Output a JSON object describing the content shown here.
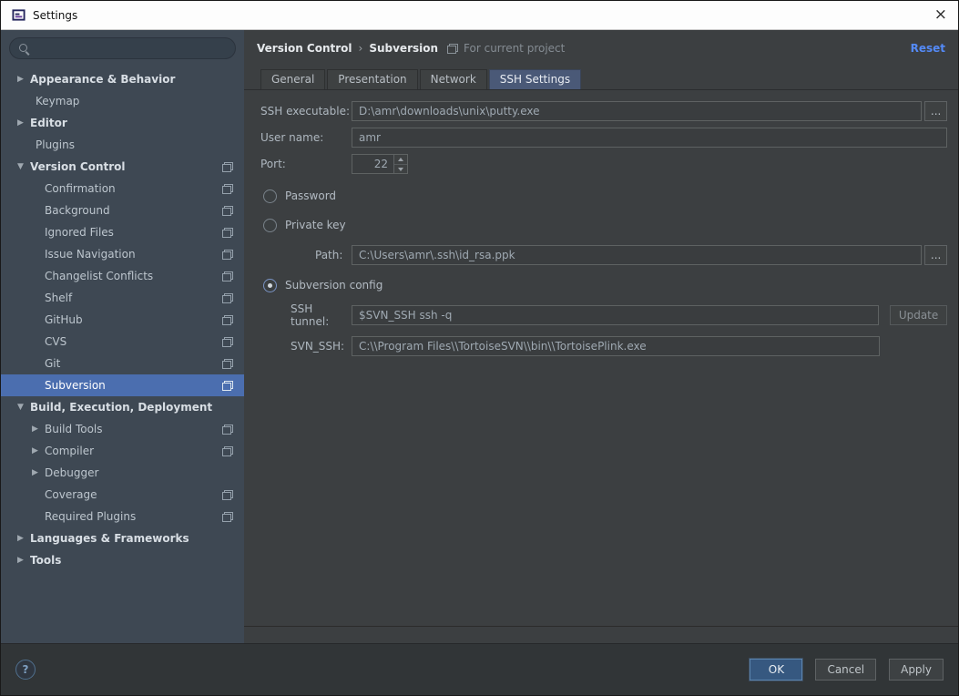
{
  "window": {
    "title": "Settings",
    "close_glyph": "×"
  },
  "colors": {
    "selection": "#4B6EAF",
    "link": "#548AF7",
    "ok_button": "#365880"
  },
  "sidebar": {
    "items": [
      {
        "label": "Appearance & Behavior"
      },
      {
        "label": "Keymap"
      },
      {
        "label": "Editor"
      },
      {
        "label": "Plugins"
      },
      {
        "label": "Version Control"
      },
      {
        "label": "Confirmation"
      },
      {
        "label": "Background"
      },
      {
        "label": "Ignored Files"
      },
      {
        "label": "Issue Navigation"
      },
      {
        "label": "Changelist Conflicts"
      },
      {
        "label": "Shelf"
      },
      {
        "label": "GitHub"
      },
      {
        "label": "CVS"
      },
      {
        "label": "Git"
      },
      {
        "label": "Subversion"
      },
      {
        "label": "Build, Execution, Deployment"
      },
      {
        "label": "Build Tools"
      },
      {
        "label": "Compiler"
      },
      {
        "label": "Debugger"
      },
      {
        "label": "Coverage"
      },
      {
        "label": "Required Plugins"
      },
      {
        "label": "Languages & Frameworks"
      },
      {
        "label": "Tools"
      }
    ]
  },
  "header": {
    "breadcrumb": [
      "Version Control",
      "Subversion"
    ],
    "separator": "›",
    "scope_note": "For current project",
    "reset_label": "Reset"
  },
  "tabs": [
    {
      "label": "General"
    },
    {
      "label": "Presentation"
    },
    {
      "label": "Network"
    },
    {
      "label": "SSH Settings"
    }
  ],
  "form": {
    "ssh_executable": {
      "label": "SSH executable:",
      "value": "D:\\amr\\downloads\\unix\\putty.exe",
      "browse_label": "..."
    },
    "user_name": {
      "label": "User name:",
      "value": "amr"
    },
    "port": {
      "label": "Port:",
      "value": "22"
    },
    "auth": {
      "password_label": "Password",
      "private_key_label": "Private key",
      "subversion_config_label": "Subversion config"
    },
    "path": {
      "label": "Path:",
      "value": "C:\\Users\\amr\\.ssh\\id_rsa.ppk",
      "browse_label": "..."
    },
    "ssh_tunnel": {
      "label": "SSH tunnel:",
      "value": "$SVN_SSH ssh -q",
      "update_label": "Update"
    },
    "svn_ssh": {
      "label": "SVN_SSH:",
      "value": "C:\\\\Program Files\\\\TortoiseSVN\\\\bin\\\\TortoisePlink.exe"
    }
  },
  "footer": {
    "help_glyph": "?",
    "ok_label": "OK",
    "cancel_label": "Cancel",
    "apply_label": "Apply"
  }
}
